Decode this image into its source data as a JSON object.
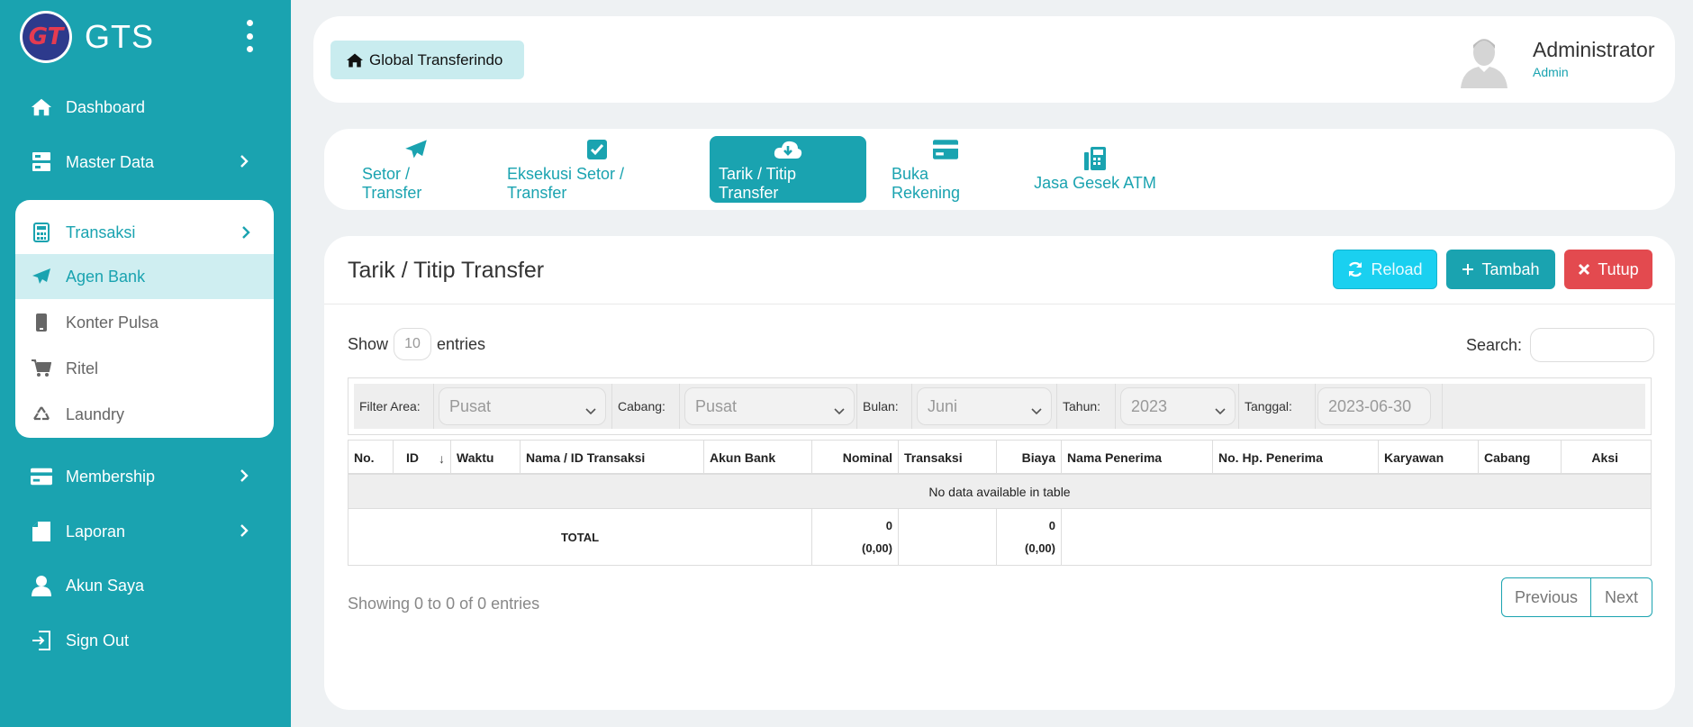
{
  "brand": {
    "name": "GTS",
    "logo_text": "GT"
  },
  "sidebar": {
    "items": [
      {
        "label": "Dashboard",
        "icon": "home-icon"
      },
      {
        "label": "Master Data",
        "icon": "server-icon"
      },
      {
        "label": "Membership",
        "icon": "credit-card-icon"
      },
      {
        "label": "Laporan",
        "icon": "book-icon"
      },
      {
        "label": "Akun Saya",
        "icon": "user-icon"
      },
      {
        "label": "Sign Out",
        "icon": "sign-out-icon"
      }
    ],
    "transaksi": {
      "label": "Transaksi",
      "icon": "calculator-icon",
      "children": [
        {
          "label": "Agen Bank",
          "icon": "paper-plane-icon",
          "active": true
        },
        {
          "label": "Konter Pulsa",
          "icon": "mobile-icon"
        },
        {
          "label": "Ritel",
          "icon": "cart-icon"
        },
        {
          "label": "Laundry",
          "icon": "recycle-icon"
        }
      ]
    }
  },
  "header": {
    "home_label": "Global Transferindo",
    "user_name": "Administrator",
    "user_role": "Admin"
  },
  "tabs": [
    {
      "label": "Setor / Transfer",
      "icon": "paper-plane-icon"
    },
    {
      "label": "Eksekusi Setor / Transfer",
      "icon": "check-square-icon"
    },
    {
      "label": "Tarik / Titip Transfer",
      "icon": "cloud-download-icon",
      "active": true
    },
    {
      "label": "Buka Rekening",
      "icon": "credit-card-icon"
    },
    {
      "label": "Jasa Gesek ATM",
      "icon": "fax-icon"
    }
  ],
  "main": {
    "title": "Tarik / Titip Transfer",
    "reload_label": "Reload",
    "tambah_label": "Tambah",
    "tutup_label": "Tutup",
    "show_label": "Show",
    "entries_value": "10",
    "entries_label": "entries",
    "search_label": "Search:"
  },
  "filters": {
    "area_label": "Filter Area:",
    "area_value": "Pusat",
    "cabang_label": "Cabang:",
    "cabang_value": "Pusat",
    "bulan_label": "Bulan:",
    "bulan_value": "Juni",
    "tahun_label": "Tahun:",
    "tahun_value": "2023",
    "tanggal_label": "Tanggal:",
    "tanggal_value": "2023-06-30"
  },
  "table": {
    "columns": [
      "No.",
      "ID",
      "Waktu",
      "Nama / ID Transaksi",
      "Akun Bank",
      "Nominal",
      "Transaksi",
      "Biaya",
      "Nama Penerima",
      "No. Hp. Penerima",
      "Karyawan",
      "Cabang",
      "Aksi"
    ],
    "empty_message": "No data available in table",
    "total_label": "TOTAL",
    "nominal_total": "0",
    "nominal_total_sub": "(0,00)",
    "biaya_total": "0",
    "biaya_total_sub": "(0,00)"
  },
  "footer": {
    "info": "Showing 0 to 0 of 0 entries",
    "prev_label": "Previous",
    "next_label": "Next"
  },
  "colors": {
    "primary": "#1aa3b0",
    "reload": "#1ad0f0",
    "danger": "#e34a4f"
  }
}
